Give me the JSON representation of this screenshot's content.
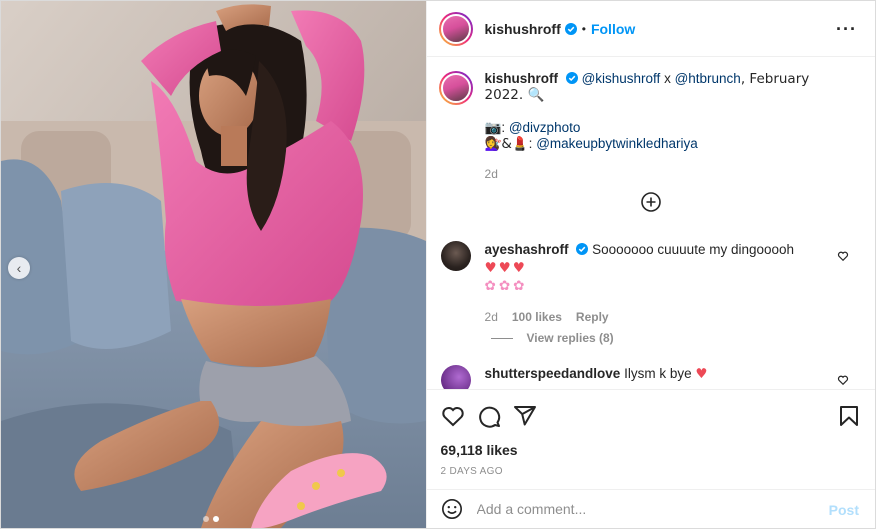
{
  "post": {
    "username": "kishushroff",
    "follow_label": "Follow",
    "bullet": "•",
    "more_label": "···"
  },
  "caption": {
    "username": "kishushroff",
    "text_mention1": "@kishushroff",
    "text_x": " x ",
    "text_mention2": "@htbrunch",
    "text_rest": ", February 2022. 🔍",
    "credit1_icon": "📷",
    "credit1_sep": ": ",
    "credit1_handle": "@divzphoto",
    "credit2_icon": "💇‍♀️&💄",
    "credit2_sep": ": ",
    "credit2_handle": "@makeupbytwinkledhariya",
    "age": "2d"
  },
  "comments": [
    {
      "username": "ayeshashroff",
      "text": "Sooooooo cuuuute my dingooooh",
      "hearts": "♥♥♥",
      "flowers": "✿✿✿",
      "age": "2d",
      "likes": "100 likes",
      "reply_label": "Reply"
    },
    {
      "username": "shutterspeedandlove",
      "text": "Ilysm k bye",
      "hearts": "♥"
    }
  ],
  "view_replies_label": "View replies (8)",
  "likes_count": "69,118 likes",
  "date_label": "2 DAYS AGO",
  "comment_box": {
    "placeholder": "Add a comment...",
    "post_label": "Post"
  },
  "carousel": {
    "prev_icon": "‹",
    "dot_count": 2,
    "active_dot": 2
  },
  "colors": {
    "accent": "#0095f6",
    "post_disabled": "#b2dffc",
    "heart": "#ed4956",
    "link": "#00376b",
    "muted": "#8e8e8e",
    "sweater": "#e8569b"
  },
  "icons": [
    "verified-badge-icon",
    "more-options-icon",
    "load-more-icon",
    "heart-icon",
    "comment-icon",
    "share-icon",
    "bookmark-icon",
    "emoji-icon",
    "chevron-left-icon"
  ]
}
